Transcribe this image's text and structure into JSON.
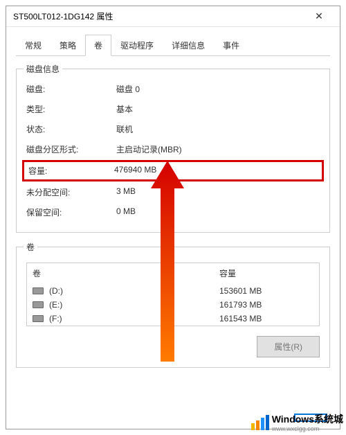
{
  "window": {
    "title": "ST500LT012-1DG142 属性",
    "close_glyph": "✕"
  },
  "tabs": {
    "items": [
      {
        "label": "常规"
      },
      {
        "label": "策略"
      },
      {
        "label": "卷"
      },
      {
        "label": "驱动程序"
      },
      {
        "label": "详细信息"
      },
      {
        "label": "事件"
      }
    ],
    "active_index": 2
  },
  "disk_info": {
    "legend": "磁盘信息",
    "rows": {
      "disk": {
        "label": "磁盘:",
        "value": "磁盘 0"
      },
      "type": {
        "label": "类型:",
        "value": "基本"
      },
      "status": {
        "label": "状态:",
        "value": "联机"
      },
      "partition": {
        "label": "磁盘分区形式:",
        "value": "主启动记录(MBR)"
      },
      "capacity": {
        "label": "容量:",
        "value": "476940 MB"
      },
      "unalloc": {
        "label": "未分配空间:",
        "value": "3 MB"
      },
      "reserved": {
        "label": "保留空间:",
        "value": "0 MB"
      }
    }
  },
  "volumes": {
    "legend": "卷",
    "headers": {
      "vol": "卷",
      "capacity": "容量"
    },
    "items": [
      {
        "name": "(D:)",
        "capacity": "153601 MB"
      },
      {
        "name": "(E:)",
        "capacity": "161793 MB"
      },
      {
        "name": "(F:)",
        "capacity": "161543 MB"
      }
    ]
  },
  "buttons": {
    "properties": "属性(R)",
    "ok_hidden": " "
  },
  "watermark": {
    "text": "Windows系统城",
    "sub": "www.wxclgg.com"
  }
}
